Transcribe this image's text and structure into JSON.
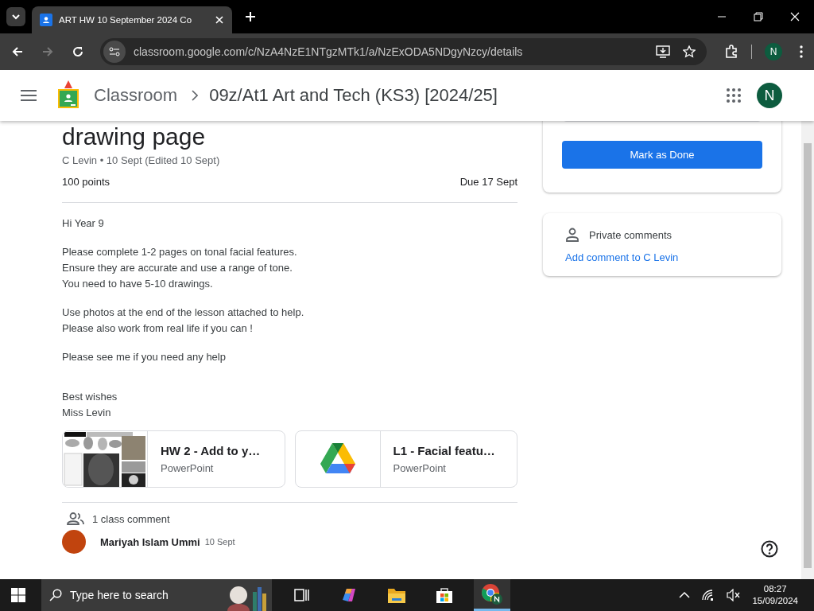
{
  "browser": {
    "tab": {
      "title": "ART HW 10 September 2024 Co",
      "selected": true
    },
    "url": "classroom.google.com/c/NzA4NzE1NTgzMTk1/a/NzExODA5NDgyNzcy/details",
    "profile": "N"
  },
  "header": {
    "app": "Classroom",
    "class_name": "09z/At1 Art and Tech (KS3) [2024/25]",
    "avatar": "N"
  },
  "assignment": {
    "title": "drawing page",
    "meta": "C Levin • 10 Sept (Edited 10 Sept)",
    "points": "100 points",
    "due": "Due 17 Sept",
    "body": [
      [
        "Hi Year 9"
      ],
      [
        "Please complete 1-2 pages on tonal facial features.",
        "Ensure they are accurate and use a range of tone.",
        "You need to have 5-10 drawings."
      ],
      [
        "Use photos at the end of the lesson attached to help.",
        "Please also work from real life if you can !"
      ],
      [
        "Please see me if you need any help"
      ],
      [
        "Best wishes",
        "Miss Levin"
      ]
    ]
  },
  "attachments": [
    {
      "kind": "picture",
      "title": "HW 2 - Add to y…",
      "type": "PowerPoint"
    },
    {
      "kind": "drive",
      "title": "L1 - Facial featu…",
      "type": "PowerPoint"
    }
  ],
  "class_comments": {
    "count": "1 class comment",
    "comments": [
      {
        "author": "Mariyah Islam Ummi",
        "time": "10 Sept"
      }
    ]
  },
  "side": {
    "button": "Mark as Done",
    "private_title": "Private comments",
    "private_link": "Add comment to C Levin"
  },
  "taskbar": {
    "search_placeholder": "Type here to search",
    "apps": [
      {
        "kind": "taskview",
        "active": false
      },
      {
        "kind": "copilot",
        "active": false
      },
      {
        "kind": "explorer",
        "active": false
      },
      {
        "kind": "store",
        "active": false
      },
      {
        "kind": "chrome",
        "active": true
      }
    ],
    "time": "08:27",
    "date": "15/09/2024"
  }
}
